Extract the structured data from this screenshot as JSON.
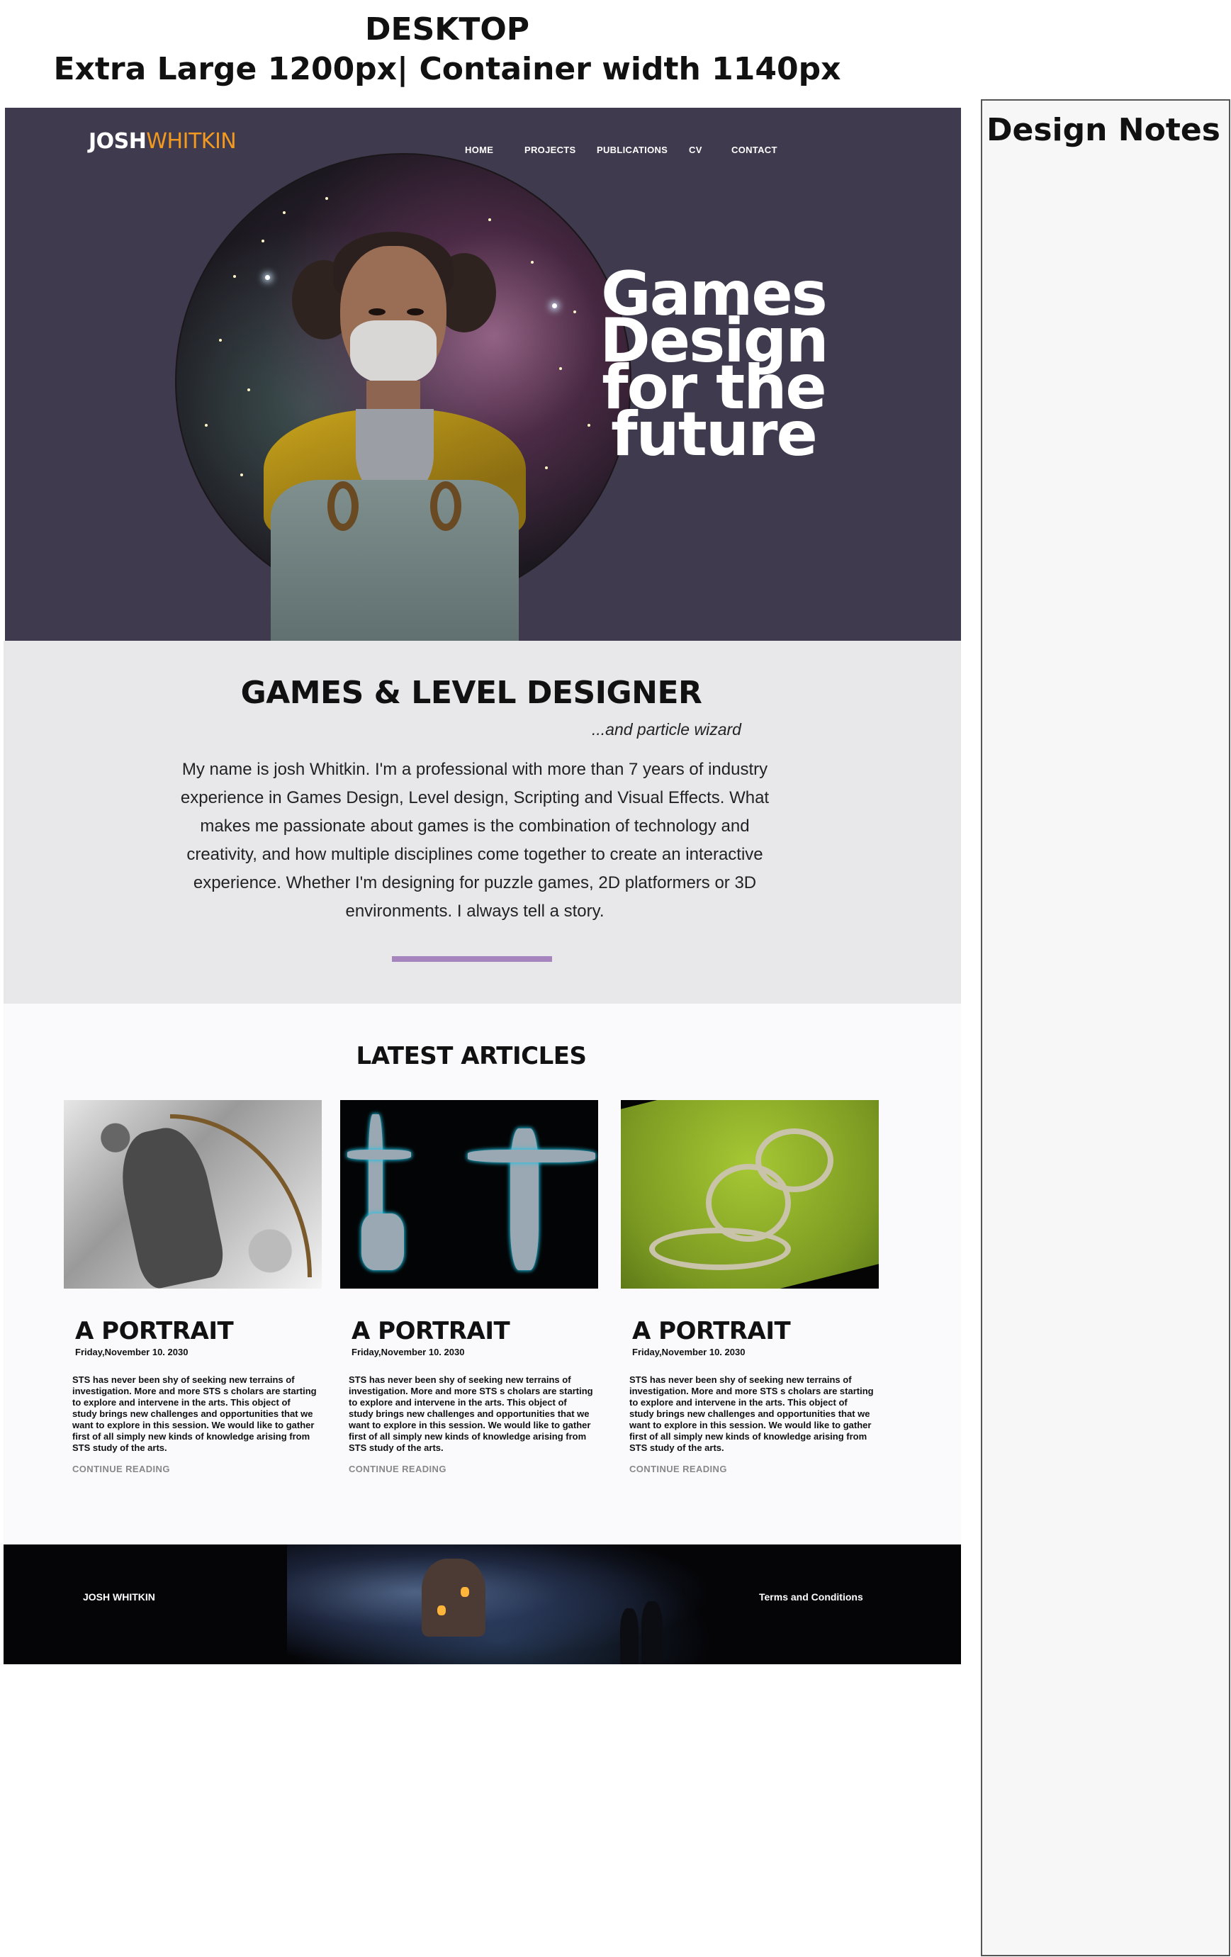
{
  "heading": {
    "line1": "DESKTOP",
    "line2": "Extra Large 1200px| Container width 1140px"
  },
  "notes": {
    "title": "Design Notes"
  },
  "site": {
    "logo_first": "JOSH",
    "logo_last": "WHITKIN",
    "nav": [
      "HOME",
      "PROJECTS",
      "PUBLICATIONS",
      "CV",
      "CONTACT"
    ],
    "hero_title_lines": [
      "Games",
      "Design",
      "for the",
      "future"
    ]
  },
  "about": {
    "title": "GAMES & LEVEL DESIGNER",
    "tagline": "...and particle wizard",
    "bio": "My  name is josh Whitkin. I'm a professional with more than 7 years of industry experience in Games Design, Level design, Scripting and Visual Effects.  What makes me passionate about games is the combination of technology  and creativity, and how multiple disciplines come together to create an interactive experience. Whether I'm designing for puzzle games, 2D platformers or 3D environments. I always tell a story.",
    "divider_color": "#a685be"
  },
  "articles": {
    "title": "LATEST ARTICLES",
    "items": [
      {
        "title": "A PORTRAIT",
        "date": "Friday,November 10. 2030",
        "body": "STS has never been shy of seeking new terrains of investigation. More and  more  STS s cholars are starting to explore and intervene in the arts.  This object of study  brings  new challenges and opportunities that we want  to explore in this session.  We would  like to gather first of all simply new kinds of  knowledge arising from  STS study of the arts.",
        "link": "CONTINUE READING",
        "image": "archer-illustration"
      },
      {
        "title": "A PORTRAIT",
        "date": "Friday,November 10. 2030",
        "body": "STS has never been shy of seeking new terrains of investigation. More and  more  STS s cholars are starting to explore and intervene in the arts.  This object of study  brings  new challenges and opportunities that we want  to explore in this session.  We would  like to gather first of all simply new kinds of  knowledge arising from  STS study of the arts.",
        "link": "CONTINUE READING",
        "image": "robot-render"
      },
      {
        "title": "A PORTRAIT",
        "date": "Friday,November 10. 2030",
        "body": "STS has never been shy of seeking new terrains of investigation. More and  more  STS s cholars are starting to explore and intervene in the arts.  This object of study  brings  new challenges and opportunities that we want  to explore in this session.  We would  like to gather first of all simply new kinds of  knowledge arising from  STS study of the arts.",
        "link": "CONTINUE READING",
        "image": "race-track-terrain"
      }
    ]
  },
  "footer": {
    "name": "JOSH WHITKIN",
    "terms": "Terms and Conditions"
  },
  "colors": {
    "hero_bg": "#3f3a4e",
    "logo_accent": "#f29a1f",
    "about_bg": "#e8e8ea",
    "articles_bg": "#fafafd",
    "footer_bg": "#050508"
  }
}
